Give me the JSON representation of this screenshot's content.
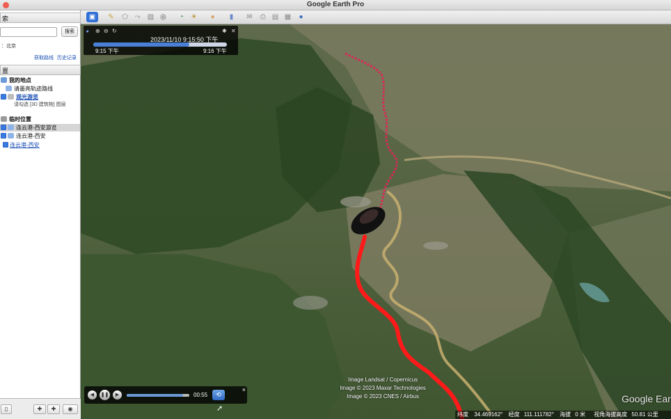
{
  "window": {
    "title": "Google Earth Pro"
  },
  "sidebar": {
    "search_header": "索",
    "search_placeholder": "",
    "search_button": "搜索",
    "location_hint": "：北京",
    "get_directions": "获取路线",
    "history": "历史记录",
    "places_header": "置",
    "places": [
      {
        "label": "我的地点",
        "style": "bold"
      },
      {
        "label": "请墨亮轨迹路线",
        "style": "normal"
      },
      {
        "label": "观光游览",
        "style": "link"
      },
      {
        "label": "请勾选 [3D 建筑物] 图层",
        "style": "note"
      },
      {
        "label": "临时位置",
        "style": "bold"
      },
      {
        "label": "连云港-西安游览",
        "style": "selected"
      },
      {
        "label": "连云港-西安",
        "style": "normal"
      },
      {
        "label": "连云港-西安",
        "style": "link"
      }
    ]
  },
  "toolbar": {
    "icons": [
      "sidebar-toggle-icon",
      "placemark-icon",
      "polygon-icon",
      "path-icon",
      "overlay-icon",
      "record-tour-icon",
      "history-icon",
      "sunlight-icon",
      "planets-icon",
      "ruler-icon",
      "email-icon",
      "print-icon",
      "save-image-icon",
      "maps-icon",
      "earth-icon"
    ]
  },
  "time_slider": {
    "date": "2023/11/10   9:15:50 下午",
    "start": "9:15 下午",
    "end": "9:16 下午",
    "progress": 0.72
  },
  "player": {
    "time": "00:55",
    "progress": 0.9,
    "close": "×"
  },
  "attribution": [
    "Image Landsat / Copernicus",
    "Image © 2023 Maxar Technologies",
    "Image © 2023 CNES / Airbus"
  ],
  "watermark": "Google Earth",
  "status": {
    "lat_label": "纬度",
    "lat": "34.469162°",
    "lon_label": "经度",
    "lon": "111.111782°",
    "elev_label": "海拔",
    "elev": "0 米",
    "eye_label": "视角海拔高度",
    "eye": "50.81 公里"
  },
  "colors": {
    "route": "#ff1a1a",
    "route_far": "#d92a55",
    "river": "#c9b070",
    "panel": "#000000"
  }
}
